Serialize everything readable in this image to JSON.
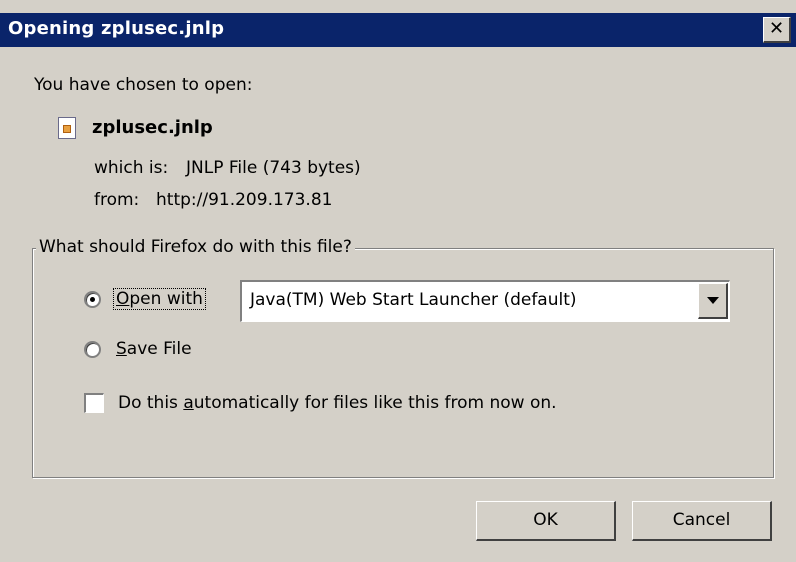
{
  "window": {
    "title": "Opening zplusec.jnlp",
    "close_glyph": "✕"
  },
  "intro_text": "You have chosen to open:",
  "file": {
    "name": "zplusec.jnlp",
    "icon": "jnlp-file-icon",
    "type_label": "which is:",
    "type_value": "JNLP File (743 bytes)",
    "from_label": "from:",
    "from_value": "http://91.209.173.81"
  },
  "action_group": {
    "legend": "What should Firefox do with this file?",
    "open_with": {
      "label_prefix": "",
      "label_mnemonic": "O",
      "label_rest": "pen with",
      "selected": true
    },
    "open_with_app": "Java(TM) Web Start Launcher (default)",
    "save_file": {
      "label_mnemonic": "S",
      "label_rest": "ave File",
      "selected": false
    },
    "auto_checkbox": {
      "label_prefix": "Do this ",
      "label_mnemonic": "a",
      "label_rest": "utomatically for files like this from now on.",
      "checked": false
    }
  },
  "buttons": {
    "ok": "OK",
    "cancel": "Cancel"
  },
  "colors": {
    "titlebar": "#0a246a",
    "face": "#d4d0c8"
  }
}
